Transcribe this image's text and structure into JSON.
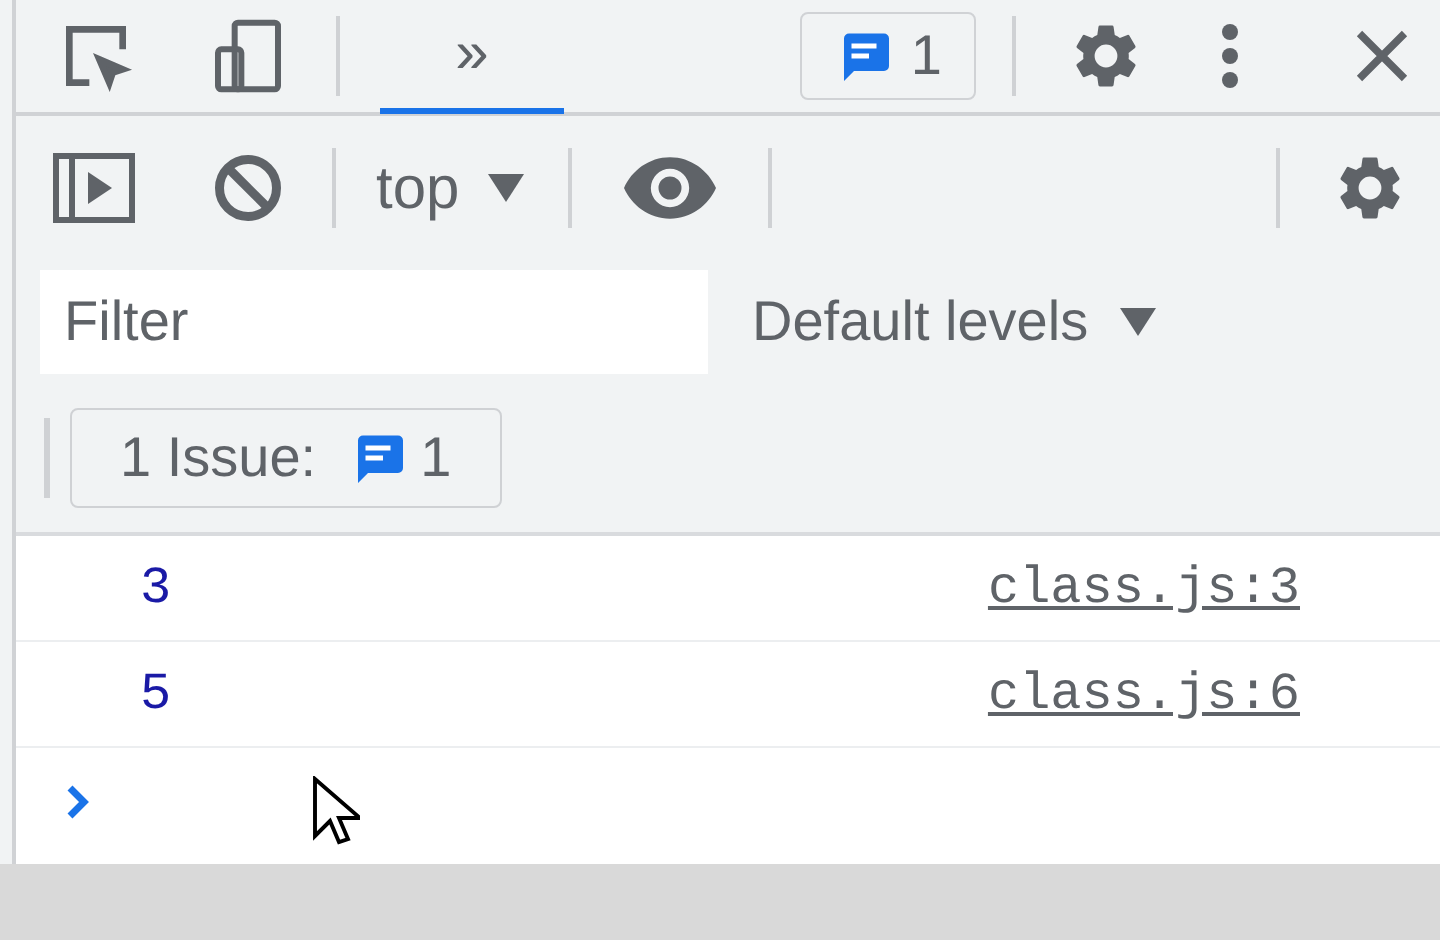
{
  "toolbar": {
    "tabs": [
      {
        "label": "»",
        "selected": true
      }
    ],
    "issues_count": "1"
  },
  "console_toolbar": {
    "context": "top"
  },
  "filter": {
    "placeholder": "Filter",
    "levels": "Default levels"
  },
  "issues_button": {
    "label": "1 Issue:",
    "count": "1"
  },
  "messages": [
    {
      "value": "3",
      "source": "class.js:3"
    },
    {
      "value": "5",
      "source": "class.js:6"
    }
  ]
}
